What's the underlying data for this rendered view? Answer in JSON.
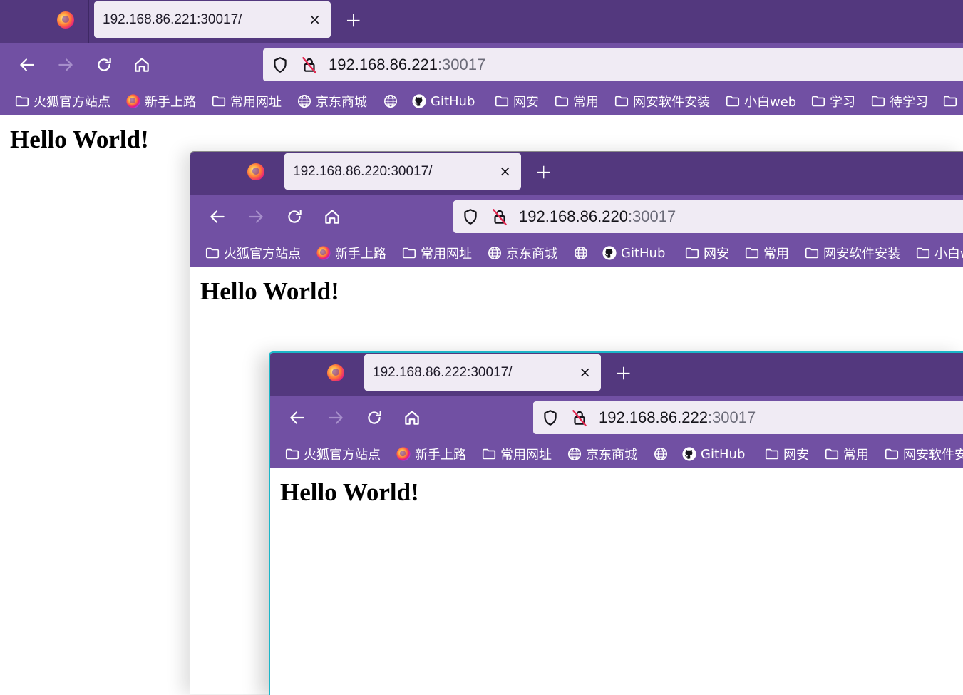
{
  "windows": [
    {
      "tab_title": "192.168.86.221:30017/",
      "url_host": "192.168.86.221",
      "url_port": ":30017",
      "heading": "Hello World!"
    },
    {
      "tab_title": "192.168.86.220:30017/",
      "url_host": "192.168.86.220",
      "url_port": ":30017",
      "heading": "Hello World!"
    },
    {
      "tab_title": "192.168.86.222:30017/",
      "url_host": "192.168.86.222",
      "url_port": ":30017",
      "heading": "Hello World!"
    }
  ],
  "tab_close": "×",
  "new_tab": "+",
  "bookmarks": [
    {
      "label": "火狐官方站点",
      "icon": "folder-icon"
    },
    {
      "label": "新手上路",
      "icon": "firefox-icon"
    },
    {
      "label": "常用网址",
      "icon": "folder-icon"
    },
    {
      "label": "京东商城",
      "icon": "globe-icon"
    },
    {
      "label": "",
      "icon": "globe-icon"
    },
    {
      "label": "GitHub",
      "icon": "github-icon"
    },
    {
      "label": "网安",
      "icon": "folder-icon"
    },
    {
      "label": "常用",
      "icon": "folder-icon"
    },
    {
      "label": "网安软件安装",
      "icon": "folder-icon"
    },
    {
      "label": "小白web",
      "icon": "folder-icon"
    },
    {
      "label": "学习",
      "icon": "folder-icon"
    },
    {
      "label": "待学习",
      "icon": "folder-icon"
    },
    {
      "label": "",
      "icon": "folder-icon"
    }
  ],
  "colors": {
    "tab_strip": "#53387e",
    "toolbar": "#7150a3",
    "active_tab": "#f0ebf4",
    "focus_border": "#1cb6c8"
  }
}
